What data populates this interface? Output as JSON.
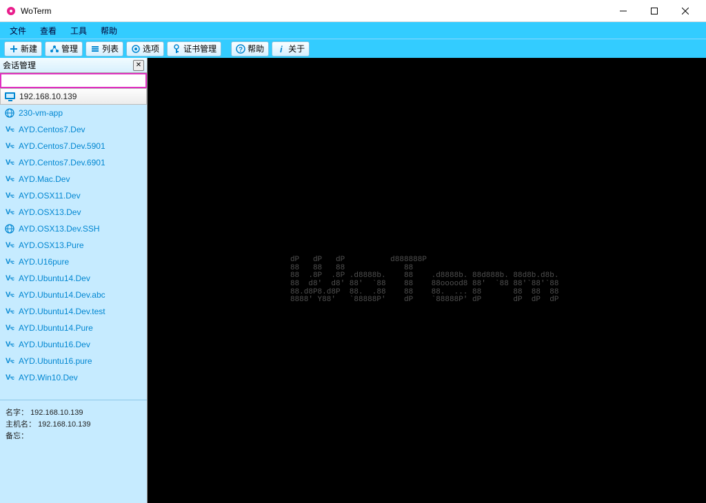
{
  "window": {
    "title": "WoTerm"
  },
  "menubar": {
    "items": [
      "文件",
      "查看",
      "工具",
      "帮助"
    ]
  },
  "toolbar": {
    "items": [
      {
        "icon": "plus",
        "label": "新建",
        "name": "new-button"
      },
      {
        "icon": "manage",
        "label": "管理",
        "name": "manage-button"
      },
      {
        "icon": "list",
        "label": "列表",
        "name": "list-button"
      },
      {
        "icon": "options",
        "label": "选项",
        "name": "options-button"
      },
      {
        "icon": "cert",
        "label": "证书管理",
        "name": "cert-button"
      },
      {
        "sep": true
      },
      {
        "icon": "help",
        "label": "帮助",
        "name": "help-button"
      },
      {
        "icon": "info",
        "label": "关于",
        "name": "about-button"
      }
    ]
  },
  "sidebar": {
    "title": "会话管理",
    "search_value": "",
    "items": [
      {
        "type": "rdp",
        "label": "192.168.10.139",
        "selected": true
      },
      {
        "type": "globe",
        "label": "230-vm-app"
      },
      {
        "type": "vnc",
        "label": "AYD.Centos7.Dev"
      },
      {
        "type": "vnc",
        "label": "AYD.Centos7.Dev.5901"
      },
      {
        "type": "vnc",
        "label": "AYD.Centos7.Dev.6901"
      },
      {
        "type": "vnc",
        "label": "AYD.Mac.Dev"
      },
      {
        "type": "vnc",
        "label": "AYD.OSX11.Dev"
      },
      {
        "type": "vnc",
        "label": "AYD.OSX13.Dev"
      },
      {
        "type": "globe",
        "label": "AYD.OSX13.Dev.SSH"
      },
      {
        "type": "vnc",
        "label": "AYD.OSX13.Pure"
      },
      {
        "type": "vnc",
        "label": "AYD.U16pure"
      },
      {
        "type": "vnc",
        "label": "AYD.Ubuntu14.Dev"
      },
      {
        "type": "vnc",
        "label": "AYD.Ubuntu14.Dev.abc"
      },
      {
        "type": "vnc",
        "label": "AYD.Ubuntu14.Dev.test"
      },
      {
        "type": "vnc",
        "label": "AYD.Ubuntu14.Pure"
      },
      {
        "type": "vnc",
        "label": "AYD.Ubuntu16.Dev"
      },
      {
        "type": "vnc",
        "label": "AYD.Ubuntu16.pure"
      },
      {
        "type": "vnc",
        "label": "AYD.Win10.Dev"
      }
    ],
    "detail": {
      "name_label": "名字",
      "name_value": "192.168.10.139",
      "host_label": "主机名",
      "host_value": "192.168.10.139",
      "memo_label": "备忘",
      "memo_value": "",
      "sep": "："
    }
  },
  "terminal": {
    "ascii": "dP   dP   dP          d888888P                              \n88   88   88             88                                 \n88  .8P  .8P .d8888b.    88    .d8888b. 88d888b. 88d8b.d8b. \n88  d8'  d8' 88'  `88    88    88ooood8 88'  `88 88'`88'`88 \n88.d8P8.d8P  88.  .88    88    88.  ... 88       88  88  88 \n8888' Y88'   `88888P'    dP    `88888P' dP       dP  dP  dP "
  }
}
